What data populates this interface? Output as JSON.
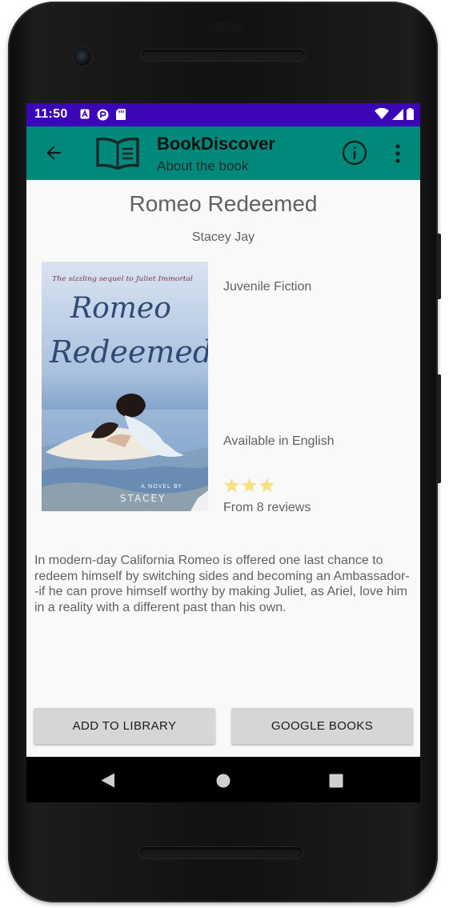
{
  "status_bar": {
    "time": "11:50",
    "left_icons": [
      "a-icon",
      "sync-icon",
      "sd-card-icon"
    ],
    "right_icons": [
      "wifi-icon",
      "signal-icon",
      "battery-icon"
    ],
    "color": "#3a06b6"
  },
  "app_bar": {
    "title": "BookDiscover",
    "subtitle": "About the book",
    "color": "#00897b",
    "icons": [
      "back-arrow-icon",
      "open-book-icon",
      "info-icon",
      "more-vert-icon"
    ]
  },
  "book": {
    "title": "Romeo Redeemed",
    "author": "Stacey Jay",
    "category": "Juvenile Fiction",
    "language": "Available in English",
    "rating_stars": 3,
    "reviews": "From 8 reviews",
    "description": "In modern-day California Romeo is offered one last chance to redeem himself by switching sides and becoming an Ambassador--if he can prove himself worthy by making Juliet, as Ariel, love him in a reality with a different past than his own.",
    "cover": {
      "tagline": "The sizzling sequel to Juliet Immortal",
      "title_line1": "Romeo",
      "title_line2": "Redeemed",
      "footer": "A NOVEL BY",
      "author_partial": "STACEY"
    }
  },
  "actions": {
    "add_library": "ADD TO LIBRARY",
    "google_books": "GOOGLE BOOKS"
  },
  "nav_bar": {
    "icons": [
      "back-triangle-icon",
      "home-circle-icon",
      "recents-square-icon"
    ]
  }
}
